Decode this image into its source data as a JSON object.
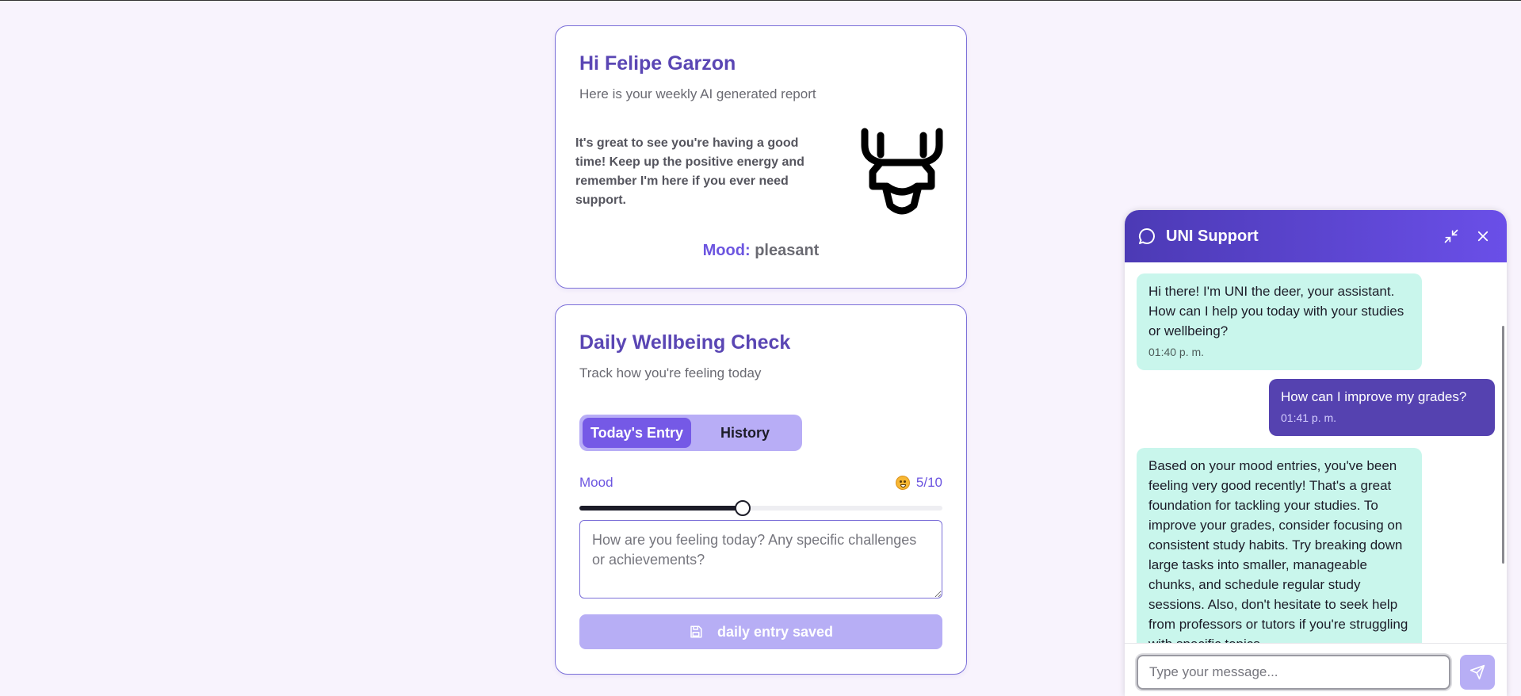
{
  "report": {
    "greeting": "Hi Felipe Garzon",
    "subtitle": "Here is your weekly AI generated report",
    "message": "It's great to see you're having a good time! Keep up the positive energy and remember I'm here if you ever need support.",
    "mood_label": "Mood:",
    "mood_value": "pleasant",
    "logo_icon": "deer-head-icon"
  },
  "wellbeing": {
    "title": "Daily Wellbeing Check",
    "subtitle": "Track how you're feeling today",
    "tabs": [
      {
        "label": "Today's Entry",
        "active": true
      },
      {
        "label": "History",
        "active": false
      }
    ],
    "mood_label": "Mood",
    "mood_emoji_icon": "grinning-face-icon",
    "mood_score": "5/10",
    "mood_fraction": 0.45,
    "entry_placeholder": "How are you feeling today? Any specific challenges or achievements?",
    "entry_value": "",
    "save_label": "daily entry saved",
    "save_icon": "floppy-disk-icon"
  },
  "chat": {
    "title": "UNI Support",
    "header_icon": "chat-bubble-icon",
    "minimize_icon": "minimize-icon",
    "close_icon": "close-icon",
    "messages": [
      {
        "role": "bot",
        "text": "Hi there! I'm UNI the deer, your assistant. How can I help you today with your studies or wellbeing?",
        "time": "01:40 p. m."
      },
      {
        "role": "user",
        "text": "How can I improve my grades?",
        "time": "01:41 p. m."
      },
      {
        "role": "bot",
        "text": "Based on your mood entries, you've been feeling very good recently! That's a great foundation for tackling your studies. To improve your grades, consider focusing on consistent study habits. Try breaking down large tasks into smaller, manageable chunks, and schedule regular study sessions. Also, don't hesitate to seek help from professors or tutors if you're struggling with specific topics.",
        "time": ""
      }
    ],
    "input_placeholder": "Type your message...",
    "send_icon": "send-icon"
  },
  "colors": {
    "accent": "#6c55e0",
    "accent_dark": "#5542b0",
    "bot_bubble": "#c9f6ec",
    "background": "#f8f3fd"
  }
}
